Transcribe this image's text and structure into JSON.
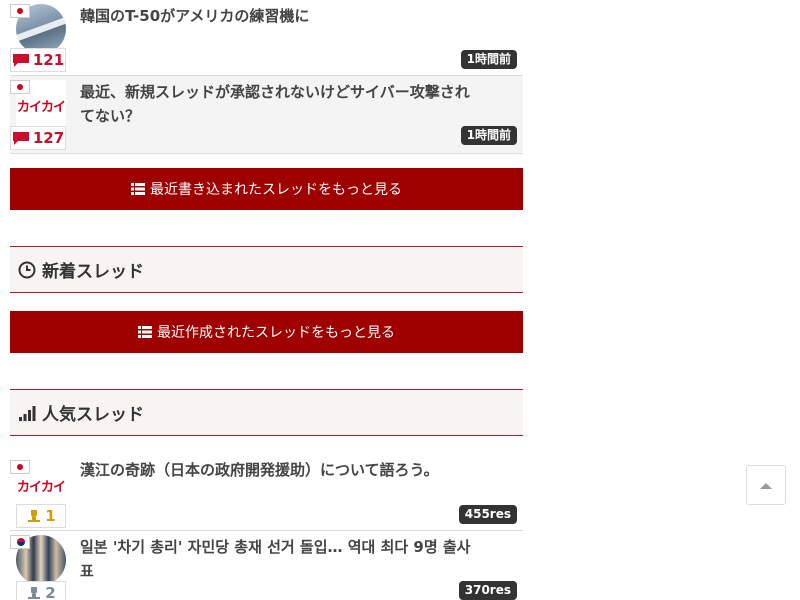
{
  "recent_threads": [
    {
      "flag": "jp",
      "thumb": "jet-photo",
      "title": "韓国のT-50がアメリカの練習機に",
      "comments": "121",
      "time": "1時間前"
    },
    {
      "flag": "jp",
      "thumb": "kaikai-logo",
      "thumb_text": "カイカイ",
      "title": "最近、新規スレッドが承認されないけどサイバー攻撃されてない？",
      "comments": "127",
      "time": "1時間前"
    }
  ],
  "buttons": {
    "more_recent_posts": "最近書き込まれたスレッドをもっと見る",
    "more_new_threads": "最近作成されたスレッドをもっと見る"
  },
  "sections": {
    "new_threads": {
      "title": "新着スレッド",
      "icon": "clock-icon"
    },
    "popular_threads": {
      "title": "人気スレッド",
      "icon": "signal-bars-icon"
    }
  },
  "popular_threads": [
    {
      "flag": "jp",
      "thumb": "kaikai-logo",
      "thumb_text": "カイカイ",
      "title": "漢江の奇跡（日本の政府開発援助）について語ろう。",
      "rank": "1",
      "res": "455res"
    },
    {
      "flag": "kr",
      "thumb": "people-photo",
      "title": "일본 '차기 총리' 자민당 총재 선거 돌입… 역대 최다 9명 출사표",
      "rank": "2",
      "res": "370res"
    }
  ],
  "colors": {
    "accent": "#9e0000",
    "section_border": "#b31b30",
    "comment_red": "#c8102e",
    "gold": "#d39e00"
  },
  "scroll_top": {
    "icon": "arrow-up-icon"
  }
}
